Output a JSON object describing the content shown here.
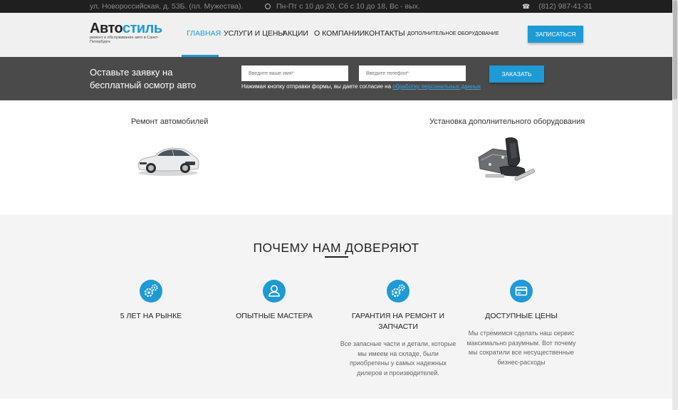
{
  "topbar": {
    "address": "ул. Новороссийская, д. 53Б. (пл. Мужества).",
    "hours": "Пн-Пт с 10 до 20, Сб с 10 до 18, Вс - вых.",
    "phone": "(812) 987-41-31"
  },
  "logo": {
    "part1": "Авто",
    "part2": "стиль",
    "tagline": "ремонт и обслуживание авто в Санкт-Петербурге"
  },
  "nav": {
    "items": [
      {
        "label": "ГЛАВНАЯ"
      },
      {
        "label": "УСЛУГИ И ЦЕНЫ"
      },
      {
        "label": "АКЦИИ"
      },
      {
        "label": "О КОМПАНИИ"
      },
      {
        "label": "КОНТАКТЫ"
      },
      {
        "label": "ДОПОЛНИТЕЛЬНОЕ ОБОРУДОВАНИЕ"
      }
    ],
    "signup": "ЗАПИСАТЬСЯ"
  },
  "form": {
    "lead": "Оставьте заявку на бесплатный осмотр авто",
    "name_placeholder": "Введите ваше имя*",
    "phone_placeholder": "Введите телефон*",
    "submit": "ЗАКАЗАТЬ",
    "consent_text": "Нажимая кнопку отправки формы, вы даете согласие на ",
    "consent_link": "обработку персональных данных"
  },
  "services": [
    {
      "title": "Ремонт автомобилей"
    },
    {
      "title": "Установка дополнительного оборудования"
    }
  ],
  "why": {
    "heading": "ПОЧЕМУ НАМ ДОВЕРЯЮТ",
    "features": [
      {
        "icon": "gears-icon",
        "title": "5 ЛЕТ НА РЫНКЕ",
        "desc": ""
      },
      {
        "icon": "user-icon",
        "title": "ОПЫТНЫЕ МАСТЕРА",
        "desc": ""
      },
      {
        "icon": "gears-icon",
        "title": "ГАРАНТИЯ НА РЕМОНТ И ЗАПЧАСТИ",
        "desc": "Все запасные части и детали, которые мы имеем на складе, были приобретены у самых надежных дилеров и производителей."
      },
      {
        "icon": "credit-card-icon",
        "title": "ДОСТУПНЫЕ ЦЕНЫ",
        "desc": "Мы стремимся сделать наш сервис максимально разумным. Вот почему мы сократили все несущественные бизнес-расходы"
      }
    ]
  },
  "colors": {
    "accent": "#1e9ad6",
    "topbar": "#1f1f1f",
    "band": "#4a4a4a"
  }
}
